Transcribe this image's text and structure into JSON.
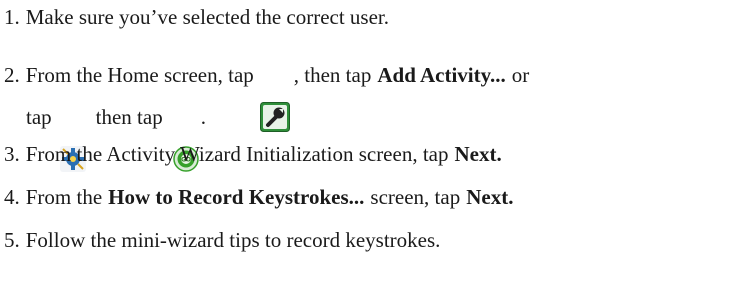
{
  "steps": [
    {
      "number": "1.",
      "parts": {
        "text": "Make sure you’ve selected the correct user."
      }
    },
    {
      "number": "2.",
      "parts": {
        "text_a": "From the Home screen, tap",
        "icon_1": "wrench-tool-icon",
        "text_b": ", then tap",
        "bold_a": "Add Activity...",
        "text_c": "or"
      }
    },
    {
      "number": "",
      "parts": {
        "text_a": "tap",
        "icon_1": "gear-settings-icon",
        "text_b": "then tap",
        "icon_2": "go-button-icon",
        "text_c": "."
      }
    },
    {
      "number": "3.",
      "parts": {
        "text_a": "From the Activity Wizard Initialization screen, tap",
        "bold_a": "Next."
      }
    },
    {
      "number": "4.",
      "parts": {
        "text_a": "From the",
        "bold_a": "How to Record Keystrokes...",
        "text_b": "screen, tap",
        "bold_b": "Next."
      }
    },
    {
      "number": "5.",
      "parts": {
        "text": "Follow the mini-wizard tips to record keystrokes."
      }
    }
  ],
  "colors": {
    "text": "#1a1a1a",
    "wrench_icon_bg": "#2f8f3a",
    "gear_icon_accent": "#2a6fb3",
    "go_icon_green": "#37a12b"
  }
}
